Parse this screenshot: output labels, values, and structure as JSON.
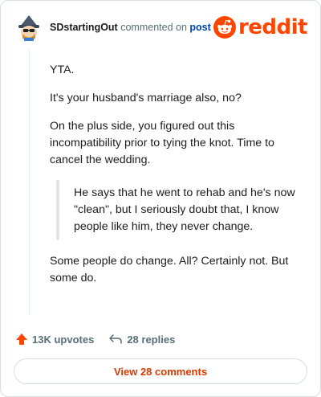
{
  "header": {
    "username": "SDstartingOut",
    "commented_on": "commented on",
    "post_link": "post",
    "logo_text": "reddit"
  },
  "comment": {
    "paragraphs": [
      "YTA.",
      "It's your husband's marriage also, no?",
      "On the plus side, you figured out this incompatibility prior to tying the knot. Time to cancel the wedding."
    ],
    "quote": "He says that he went to rehab and he's now \"clean\", but I seriously doubt that, I know people like him, they never change.",
    "closing": "Some people do change. All? Certainly not. But some do."
  },
  "actions": {
    "upvotes": "13K upvotes",
    "replies": "28 replies"
  },
  "footer": {
    "view_comments": "View 28 comments"
  },
  "colors": {
    "brand": "#ff4500",
    "link": "#0045ac",
    "button_text": "#d93a00",
    "muted": "#576f76"
  },
  "icons": {
    "avatar": "snoo-avatar",
    "logo": "reddit-snoo-icon",
    "upvote": "upvote-arrow-icon",
    "reply": "reply-arrow-icon"
  }
}
